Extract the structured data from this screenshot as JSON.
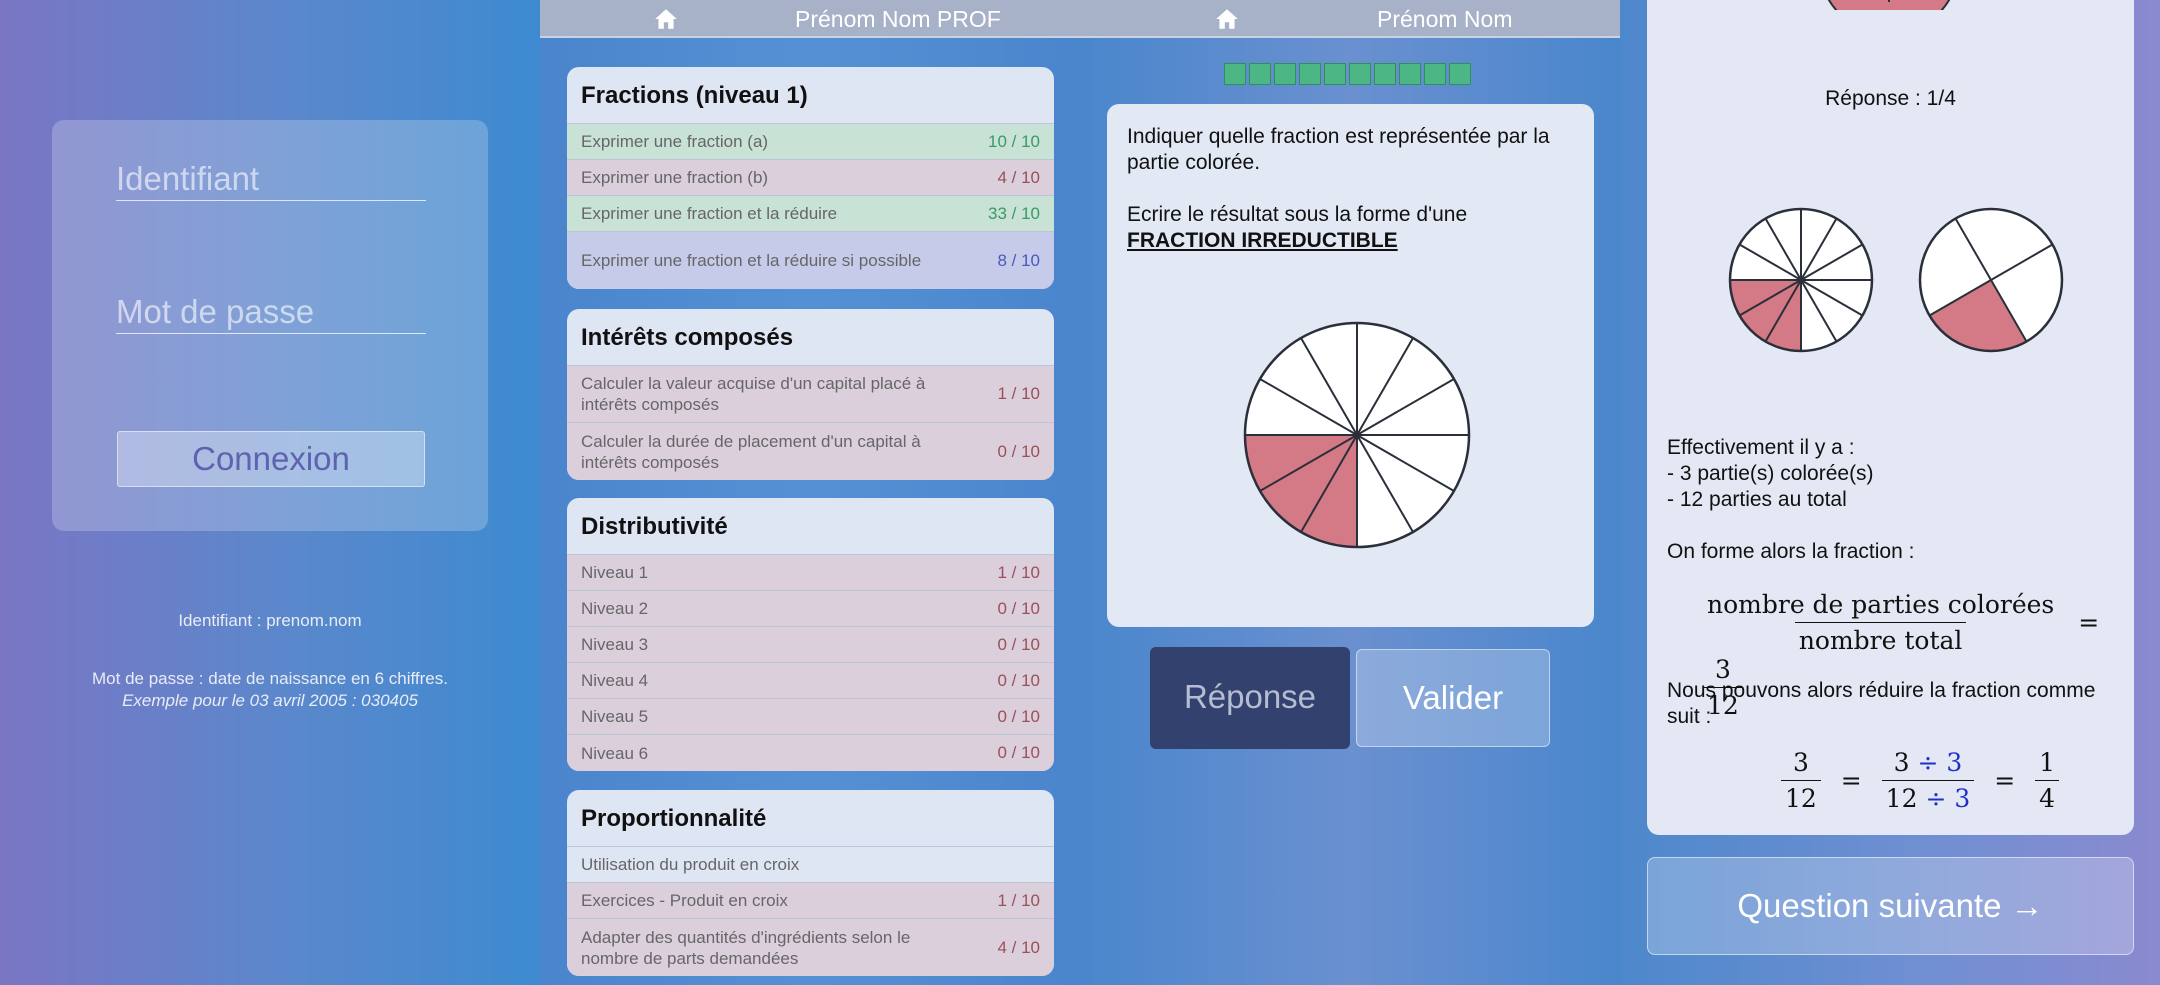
{
  "login": {
    "username_placeholder": "Identifiant",
    "password_placeholder": "Mot de passe",
    "button": "Connexion",
    "hint_username": "Identifiant : prenom.nom",
    "hint_password": "Mot de passe : date de naissance en 6 chiffres.",
    "hint_example": "Exemple pour le 03 avril 2005 : 030405"
  },
  "list_screen": {
    "header": "Prénom Nom PROF",
    "sections": [
      {
        "title": "Fractions (niveau 1)",
        "items": [
          {
            "label": "Exprimer une fraction (a)",
            "score": "10 / 10",
            "status": "green"
          },
          {
            "label": "Exprimer une fraction (b)",
            "score": "4 / 10",
            "status": "red"
          },
          {
            "label": "Exprimer une fraction et la réduire",
            "score": "33 / 10",
            "status": "green"
          },
          {
            "label": "Exprimer une fraction et la réduire si possible",
            "score": "8 / 10",
            "status": "blue"
          }
        ]
      },
      {
        "title": "Intérêts composés",
        "items": [
          {
            "label": "Calculer la valeur acquise d'un capital placé à intérêts composés",
            "score": "1 / 10",
            "status": "red"
          },
          {
            "label": "Calculer la durée de placement d'un capital à intérêts composés",
            "score": "0 / 10",
            "status": "red"
          }
        ]
      },
      {
        "title": "Distributivité",
        "items": [
          {
            "label": "Niveau 1",
            "score": "1 / 10",
            "status": "red"
          },
          {
            "label": "Niveau 2",
            "score": "0 / 10",
            "status": "red"
          },
          {
            "label": "Niveau 3",
            "score": "0 / 10",
            "status": "red"
          },
          {
            "label": "Niveau 4",
            "score": "0 / 10",
            "status": "red"
          },
          {
            "label": "Niveau 5",
            "score": "0 / 10",
            "status": "red"
          },
          {
            "label": "Niveau 6",
            "score": "0 / 10",
            "status": "red"
          }
        ]
      },
      {
        "title": "Proportionnalité",
        "items": [
          {
            "label": "Utilisation du produit en croix",
            "score": "",
            "status": "none"
          },
          {
            "label": "Exercices - Produit en croix",
            "score": "1 / 10",
            "status": "red"
          },
          {
            "label": "Adapter des quantités d'ingrédients selon le nombre de parts demandées",
            "score": "4 / 10",
            "status": "red"
          }
        ]
      }
    ]
  },
  "question_screen": {
    "header": "Prénom Nom",
    "progress_done": 10,
    "progress_total": 10,
    "question_line1": "Indiquer quelle fraction est représentée par la partie colorée.",
    "question_line2": "Ecrire le résultat sous la forme d'une",
    "question_emph": "FRACTION IRREDUCTIBLE",
    "pie": {
      "parts": 12,
      "colored": 3
    },
    "btn_answer": "Réponse",
    "btn_validate": "Valider"
  },
  "answer_screen": {
    "response": "Réponse : 1/4",
    "pie_left": {
      "parts": 12,
      "colored": 3
    },
    "pie_right": {
      "parts": 4,
      "colored": 1
    },
    "explain_1": "Effectivement il y a :",
    "explain_2": "- 3 partie(s) colorée(s)",
    "explain_3": "- 12 parties au total",
    "explain_4": "On forme alors la fraction :",
    "frac_num_text": "nombre de parties colorées",
    "frac_den_text": "nombre total",
    "frac_num": "3",
    "frac_den": "12",
    "explain_5": "Nous pouvons alors réduire la fraction comme suit :",
    "red_num": "3",
    "red_div_num": "÷ 3",
    "red_den": "12",
    "red_div_den": "÷ 3",
    "res_num": "1",
    "res_den": "4",
    "next_button": "Question suivante →"
  },
  "colors": {
    "pie_fill": "#d47a86",
    "stroke": "#2a2f3a",
    "progress": "#4cb784"
  }
}
